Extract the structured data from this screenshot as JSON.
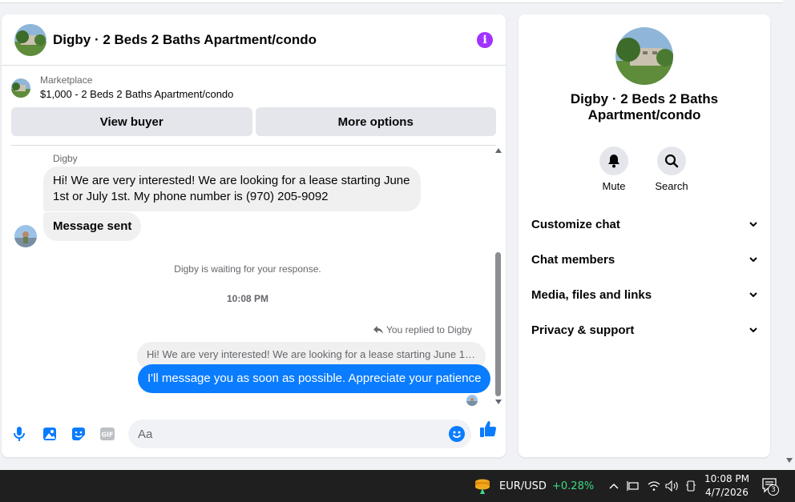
{
  "chat": {
    "title": "Digby · 2 Beds 2 Baths Apartment/condo",
    "listing": {
      "category": "Marketplace",
      "price_title": "$1,000 - 2 Beds 2 Baths Apartment/condo"
    },
    "buttons": {
      "view_buyer": "View buyer",
      "more_options": "More options"
    },
    "messages": {
      "sender_name": "Digby",
      "incoming_1": "Hi! We are very interested! We are looking for a lease starting June 1st or July 1st. My phone number is (970) 205-9092",
      "incoming_2": "Message sent",
      "waiting_notice": "Digby is waiting for your response.",
      "time_separator": "10:08 PM",
      "replied_label": "You replied to Digby",
      "quoted_text": "Hi! We are very interested! We are looking for a lease starting June 1st...",
      "outgoing_1": "I'll message you as soon as possible. Appreciate your patience"
    },
    "composer": {
      "placeholder": "Aa"
    }
  },
  "info_panel": {
    "title": "Digby · 2 Beds 2 Baths Apartment/condo",
    "actions": [
      {
        "label": "Mute",
        "icon": "bell-icon"
      },
      {
        "label": "Search",
        "icon": "search-icon"
      }
    ],
    "sections": [
      {
        "label": "Customize chat"
      },
      {
        "label": "Chat members"
      },
      {
        "label": "Media, files and links"
      },
      {
        "label": "Privacy & support"
      }
    ]
  },
  "taskbar": {
    "ticker_symbol": "EUR/USD",
    "ticker_change": "+0.28%",
    "time": "10:08 PM",
    "date": "4/7/2026",
    "notification_count": "3"
  },
  "colors": {
    "accent_blue": "#0a7cff",
    "info_purple": "#a033ff",
    "ticker_green": "#3ddc84"
  }
}
